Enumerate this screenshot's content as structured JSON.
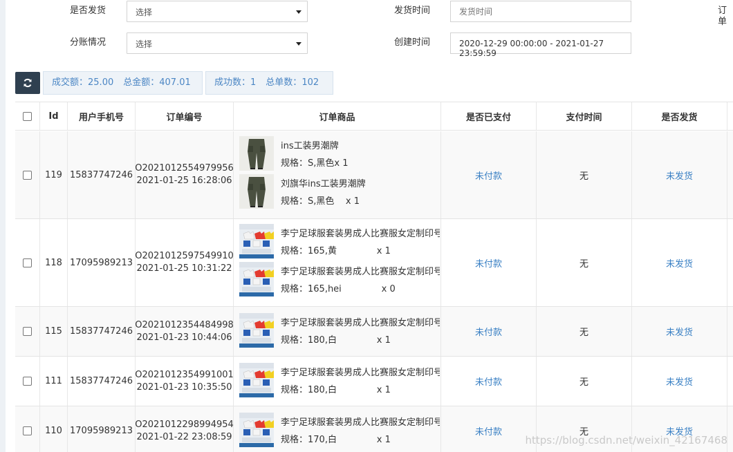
{
  "filters": {
    "shipped_label": "是否发货",
    "shipped_placeholder": "选择",
    "ship_time_label": "发货时间",
    "ship_time_placeholder": "发货时间",
    "order_label_partial": "订单",
    "split_label": "分账情况",
    "split_placeholder": "选择",
    "create_time_label": "创建时间",
    "create_time_value": "2020-12-29 00:00:00 - 2021-01-27 23:59:59"
  },
  "stats": {
    "deal_amount_label": "成交额：",
    "deal_amount": "25.00",
    "total_amount_label": "总金额：",
    "total_amount": "407.01",
    "success_count_label": "成功数：",
    "success_count": "1",
    "total_orders_label": "总单数：",
    "total_orders": "102"
  },
  "table": {
    "headers": [
      "Id",
      "用户手机号",
      "订单编号",
      "订单商品",
      "是否已支付",
      "支付时间",
      "是否发货"
    ],
    "rows": [
      {
        "id": "119",
        "phone": "15837747246",
        "order_no": "O2021012554979956",
        "order_time": "2021-01-25 16:28:06",
        "products": [
          {
            "title": " ins工装男潮牌",
            "spec": "规格：S,黑色x 1",
            "thumb": "pants"
          },
          {
            "title": "刘旗华ins工装男潮牌",
            "spec": "规格：S,黑色    x 1",
            "thumb": "pants"
          }
        ],
        "paid": "未付款",
        "pay_time": "无",
        "shipped": "未发货"
      },
      {
        "id": "118",
        "phone": "17095989213",
        "order_no": "O2021012597549910",
        "order_time": "2021-01-25 10:31:22",
        "products": [
          {
            "title": "李宁足球服套装男成人比赛服女定制印号",
            "spec": "规格：165,黄              x 1",
            "thumb": "jersey"
          },
          {
            "title": "李宁足球服套装男成人比赛服女定制印号",
            "spec": "规格：165,hei              x 0",
            "thumb": "jersey"
          }
        ],
        "paid": "未付款",
        "pay_time": "无",
        "shipped": "未发货"
      },
      {
        "id": "115",
        "phone": "15837747246",
        "order_no": "O2021012354484998",
        "order_time": "2021-01-23 10:44:06",
        "products": [
          {
            "title": "李宁足球服套装男成人比赛服女定制印号",
            "spec": "规格：180,白              x 1",
            "thumb": "jersey"
          }
        ],
        "paid": "未付款",
        "pay_time": "无",
        "shipped": "未发货"
      },
      {
        "id": "111",
        "phone": "15837747246",
        "order_no": "O2021012354991001",
        "order_time": "2021-01-23 10:35:50",
        "products": [
          {
            "title": "李宁足球服套装男成人比赛服女定制印号",
            "spec": "规格：180,白              x 1",
            "thumb": "jersey"
          }
        ],
        "paid": "未付款",
        "pay_time": "无",
        "shipped": "未发货"
      },
      {
        "id": "110",
        "phone": "17095989213",
        "order_no": "O2021012298994954",
        "order_time": "2021-01-22 23:08:59",
        "products": [
          {
            "title": "李宁足球服套装男成人比赛服女定制印号",
            "spec": "规格：170,白              x 1",
            "thumb": "jersey"
          }
        ],
        "paid": "未付款",
        "pay_time": "无",
        "shipped": "未发货"
      }
    ]
  },
  "watermark": "https://blog.csdn.net/weixin_42167468",
  "colors": {
    "link": "#3a80c4",
    "refresh_bg": "#2f4050",
    "stat_text": "#4b86c4"
  },
  "icons": {
    "refresh": "refresh-icon",
    "caret": "caret-down-icon"
  }
}
